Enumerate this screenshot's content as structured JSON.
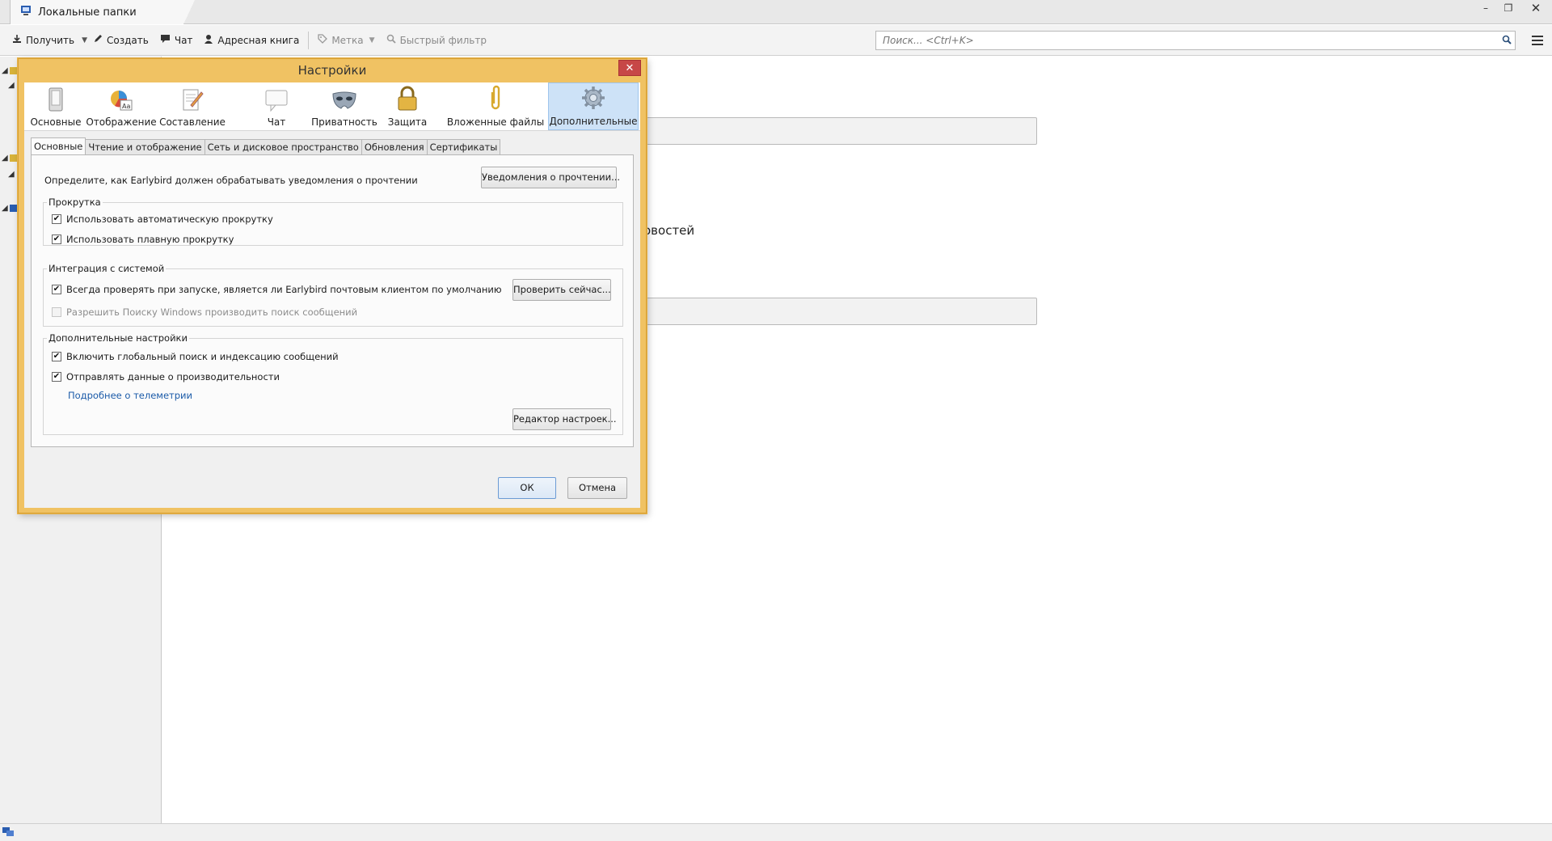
{
  "window": {
    "tab_title": "Локальные папки",
    "minimize": "–",
    "restore": "❐",
    "close": "✕"
  },
  "toolbar": {
    "get_label": "Получить",
    "create_label": "Создать",
    "chat_label": "Чат",
    "addressbook_label": "Адресная книга",
    "tag_label": "Метка",
    "quickfilter_label": "Быстрый фильтр",
    "search_placeholder": "Поиск... <Ctrl+K>"
  },
  "background": {
    "partial_text": "овостей"
  },
  "dialog": {
    "title": "Настройки",
    "categories": [
      {
        "label": "Основные",
        "icon": "general-icon"
      },
      {
        "label": "Отображение",
        "icon": "display-icon"
      },
      {
        "label": "Составление",
        "icon": "composition-icon"
      },
      {
        "label": "Чат",
        "icon": "chat-icon"
      },
      {
        "label": "Приватность",
        "icon": "privacy-mask-icon"
      },
      {
        "label": "Защита",
        "icon": "security-lock-icon"
      },
      {
        "label": "Вложенные файлы",
        "icon": "attachment-clip-icon"
      },
      {
        "label": "Дополнительные",
        "icon": "advanced-gear-icon",
        "active": true
      }
    ],
    "subtabs": [
      {
        "label": "Основные",
        "active": true
      },
      {
        "label": "Чтение и отображение"
      },
      {
        "label": "Сеть и дисковое пространство"
      },
      {
        "label": "Обновления"
      },
      {
        "label": "Сертификаты"
      }
    ],
    "receipts_text": "Определите, как Earlybird должен обрабатывать уведомления о прочтении",
    "receipts_button": "Уведомления о прочтении...",
    "scrolling": {
      "legend": "Прокрутка",
      "autoscroll": {
        "label": "Использовать автоматическую прокрутку",
        "checked": true
      },
      "smooth": {
        "label": "Использовать плавную прокрутку",
        "checked": true
      }
    },
    "integration": {
      "legend": "Интеграция с системой",
      "default_check": {
        "label": "Всегда проверять при запуске, является ли Earlybird почтовым клиентом по умолчанию",
        "checked": true
      },
      "check_now_button": "Проверить сейчас...",
      "windows_search": {
        "label": "Разрешить Поиску Windows производить поиск сообщений",
        "checked": false,
        "disabled": true
      }
    },
    "advanced": {
      "legend": "Дополнительные настройки",
      "global_search": {
        "label": "Включить глобальный поиск и индексацию сообщений",
        "checked": true
      },
      "telemetry": {
        "label": "Отправлять данные о производительности",
        "checked": true
      },
      "telemetry_link": "Подробнее о телеметрии",
      "config_editor_button": "Редактор настроек..."
    },
    "ok_button": "ОК",
    "cancel_button": "Отмена"
  },
  "colors": {
    "dialog_frame": "#f0c263",
    "active_category": "#cde2f7",
    "link": "#1a5aa8",
    "close_button": "#c74747"
  }
}
